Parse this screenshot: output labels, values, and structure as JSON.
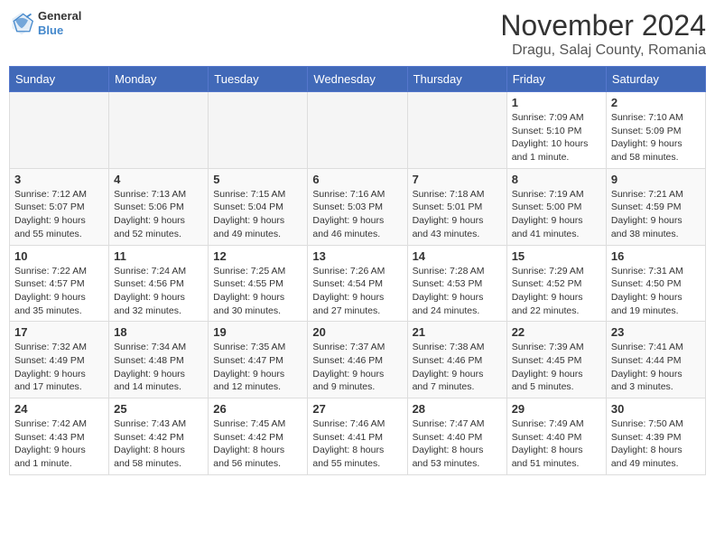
{
  "header": {
    "logo_line1": "General",
    "logo_line2": "Blue",
    "month_title": "November 2024",
    "location": "Dragu, Salaj County, Romania"
  },
  "weekdays": [
    "Sunday",
    "Monday",
    "Tuesday",
    "Wednesday",
    "Thursday",
    "Friday",
    "Saturday"
  ],
  "weeks": [
    [
      {
        "day": "",
        "info": ""
      },
      {
        "day": "",
        "info": ""
      },
      {
        "day": "",
        "info": ""
      },
      {
        "day": "",
        "info": ""
      },
      {
        "day": "",
        "info": ""
      },
      {
        "day": "1",
        "info": "Sunrise: 7:09 AM\nSunset: 5:10 PM\nDaylight: 10 hours and 1 minute."
      },
      {
        "day": "2",
        "info": "Sunrise: 7:10 AM\nSunset: 5:09 PM\nDaylight: 9 hours and 58 minutes."
      }
    ],
    [
      {
        "day": "3",
        "info": "Sunrise: 7:12 AM\nSunset: 5:07 PM\nDaylight: 9 hours and 55 minutes."
      },
      {
        "day": "4",
        "info": "Sunrise: 7:13 AM\nSunset: 5:06 PM\nDaylight: 9 hours and 52 minutes."
      },
      {
        "day": "5",
        "info": "Sunrise: 7:15 AM\nSunset: 5:04 PM\nDaylight: 9 hours and 49 minutes."
      },
      {
        "day": "6",
        "info": "Sunrise: 7:16 AM\nSunset: 5:03 PM\nDaylight: 9 hours and 46 minutes."
      },
      {
        "day": "7",
        "info": "Sunrise: 7:18 AM\nSunset: 5:01 PM\nDaylight: 9 hours and 43 minutes."
      },
      {
        "day": "8",
        "info": "Sunrise: 7:19 AM\nSunset: 5:00 PM\nDaylight: 9 hours and 41 minutes."
      },
      {
        "day": "9",
        "info": "Sunrise: 7:21 AM\nSunset: 4:59 PM\nDaylight: 9 hours and 38 minutes."
      }
    ],
    [
      {
        "day": "10",
        "info": "Sunrise: 7:22 AM\nSunset: 4:57 PM\nDaylight: 9 hours and 35 minutes."
      },
      {
        "day": "11",
        "info": "Sunrise: 7:24 AM\nSunset: 4:56 PM\nDaylight: 9 hours and 32 minutes."
      },
      {
        "day": "12",
        "info": "Sunrise: 7:25 AM\nSunset: 4:55 PM\nDaylight: 9 hours and 30 minutes."
      },
      {
        "day": "13",
        "info": "Sunrise: 7:26 AM\nSunset: 4:54 PM\nDaylight: 9 hours and 27 minutes."
      },
      {
        "day": "14",
        "info": "Sunrise: 7:28 AM\nSunset: 4:53 PM\nDaylight: 9 hours and 24 minutes."
      },
      {
        "day": "15",
        "info": "Sunrise: 7:29 AM\nSunset: 4:52 PM\nDaylight: 9 hours and 22 minutes."
      },
      {
        "day": "16",
        "info": "Sunrise: 7:31 AM\nSunset: 4:50 PM\nDaylight: 9 hours and 19 minutes."
      }
    ],
    [
      {
        "day": "17",
        "info": "Sunrise: 7:32 AM\nSunset: 4:49 PM\nDaylight: 9 hours and 17 minutes."
      },
      {
        "day": "18",
        "info": "Sunrise: 7:34 AM\nSunset: 4:48 PM\nDaylight: 9 hours and 14 minutes."
      },
      {
        "day": "19",
        "info": "Sunrise: 7:35 AM\nSunset: 4:47 PM\nDaylight: 9 hours and 12 minutes."
      },
      {
        "day": "20",
        "info": "Sunrise: 7:37 AM\nSunset: 4:46 PM\nDaylight: 9 hours and 9 minutes."
      },
      {
        "day": "21",
        "info": "Sunrise: 7:38 AM\nSunset: 4:46 PM\nDaylight: 9 hours and 7 minutes."
      },
      {
        "day": "22",
        "info": "Sunrise: 7:39 AM\nSunset: 4:45 PM\nDaylight: 9 hours and 5 minutes."
      },
      {
        "day": "23",
        "info": "Sunrise: 7:41 AM\nSunset: 4:44 PM\nDaylight: 9 hours and 3 minutes."
      }
    ],
    [
      {
        "day": "24",
        "info": "Sunrise: 7:42 AM\nSunset: 4:43 PM\nDaylight: 9 hours and 1 minute."
      },
      {
        "day": "25",
        "info": "Sunrise: 7:43 AM\nSunset: 4:42 PM\nDaylight: 8 hours and 58 minutes."
      },
      {
        "day": "26",
        "info": "Sunrise: 7:45 AM\nSunset: 4:42 PM\nDaylight: 8 hours and 56 minutes."
      },
      {
        "day": "27",
        "info": "Sunrise: 7:46 AM\nSunset: 4:41 PM\nDaylight: 8 hours and 55 minutes."
      },
      {
        "day": "28",
        "info": "Sunrise: 7:47 AM\nSunset: 4:40 PM\nDaylight: 8 hours and 53 minutes."
      },
      {
        "day": "29",
        "info": "Sunrise: 7:49 AM\nSunset: 4:40 PM\nDaylight: 8 hours and 51 minutes."
      },
      {
        "day": "30",
        "info": "Sunrise: 7:50 AM\nSunset: 4:39 PM\nDaylight: 8 hours and 49 minutes."
      }
    ]
  ]
}
